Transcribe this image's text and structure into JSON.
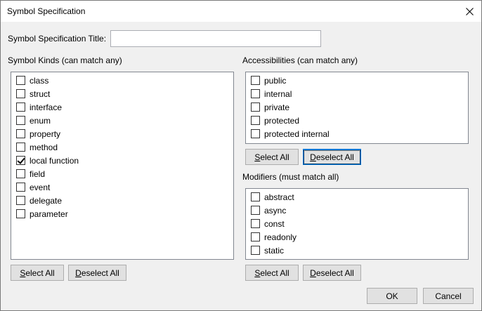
{
  "window": {
    "title": "Symbol Specification"
  },
  "spec_title": {
    "label": "Symbol Specification Title:",
    "value": ""
  },
  "symbol_kinds": {
    "heading": "Symbol Kinds (can match any)",
    "items": [
      {
        "label": "class",
        "checked": false
      },
      {
        "label": "struct",
        "checked": false
      },
      {
        "label": "interface",
        "checked": false
      },
      {
        "label": "enum",
        "checked": false
      },
      {
        "label": "property",
        "checked": false
      },
      {
        "label": "method",
        "checked": false
      },
      {
        "label": "local function",
        "checked": true
      },
      {
        "label": "field",
        "checked": false
      },
      {
        "label": "event",
        "checked": false
      },
      {
        "label": "delegate",
        "checked": false
      },
      {
        "label": "parameter",
        "checked": false
      }
    ],
    "select_all": "Select All",
    "deselect_all": "Deselect All"
  },
  "accessibilities": {
    "heading": "Accessibilities (can match any)",
    "items": [
      {
        "label": "public",
        "checked": false
      },
      {
        "label": "internal",
        "checked": false
      },
      {
        "label": "private",
        "checked": false
      },
      {
        "label": "protected",
        "checked": false
      },
      {
        "label": "protected internal",
        "checked": false
      }
    ],
    "select_all": "Select All",
    "deselect_all": "Deselect All"
  },
  "modifiers": {
    "heading": "Modifiers (must match all)",
    "items": [
      {
        "label": "abstract",
        "checked": false
      },
      {
        "label": "async",
        "checked": false
      },
      {
        "label": "const",
        "checked": false
      },
      {
        "label": "readonly",
        "checked": false
      },
      {
        "label": "static",
        "checked": false
      }
    ],
    "select_all": "Select All",
    "deselect_all": "Deselect All"
  },
  "footer": {
    "ok": "OK",
    "cancel": "Cancel"
  }
}
